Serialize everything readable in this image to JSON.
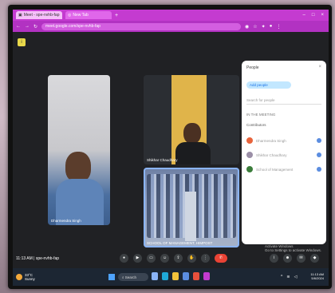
{
  "browser": {
    "tabs": [
      {
        "label": "Meet - spe-nvhb-fap",
        "active": true
      },
      {
        "label": "New Tab",
        "active": false
      }
    ],
    "url": "meet.google.com/spe-nvhb-fap"
  },
  "meet": {
    "participants": [
      {
        "name": "Dharmendra Singh"
      },
      {
        "name": "Shikhar Chaudhary"
      },
      {
        "name": "SCHOOL OF MANAGEMENT, HIMPOST"
      }
    ],
    "meeting_info": "11:13 AM | spe-nvhb-fap",
    "panel": {
      "title": "People",
      "add_label": "Add people",
      "search_placeholder": "Search for people",
      "section_label": "IN THE MEETING",
      "subsection_label": "Contributors",
      "people": [
        {
          "name": "Dharmendra Singh",
          "color": "#e8643c"
        },
        {
          "name": "Shikhar Chaudhary",
          "color": "#9b8fa7"
        },
        {
          "name": "School of Management",
          "color": "#3b7d3b"
        }
      ]
    },
    "activate_windows": {
      "line1": "Activate Windows",
      "line2": "Go to Settings to activate Windows."
    }
  },
  "taskbar": {
    "weather_temp": "33°C",
    "weather_desc": "Sunny",
    "search_label": "Search",
    "time": "11:13 AM",
    "date": "5/6/2024",
    "accent": "#4ea3ff"
  }
}
